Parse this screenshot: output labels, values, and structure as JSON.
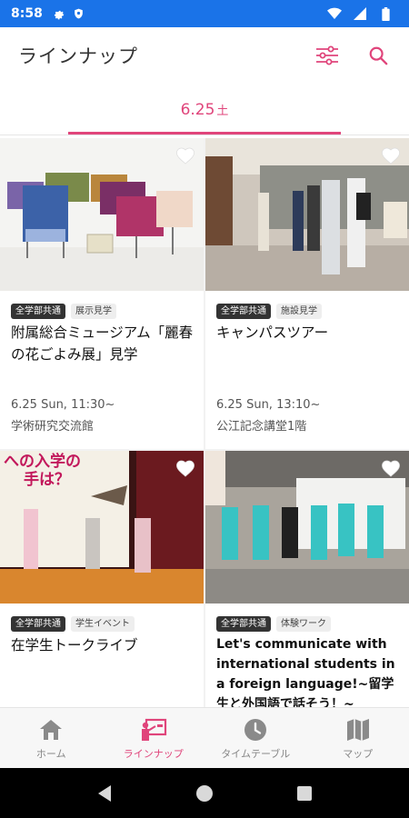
{
  "status_bar": {
    "time": "8:58"
  },
  "app_bar": {
    "title": "ラインナップ"
  },
  "date_tab": {
    "date": "6.25",
    "weekday": "土"
  },
  "cards": [
    {
      "tags": [
        "全学部共通",
        "展示見学"
      ],
      "title": "附属総合ミュージアム「麗春の花ごよみ展」見学",
      "date": "6.25 Sun, 11:30~",
      "place": "学術研究交流館"
    },
    {
      "tags": [
        "全学部共通",
        "施設見学"
      ],
      "title": "キャンパスツアー",
      "date": "6.25 Sun, 13:10~",
      "place": "公江記念講堂1階"
    },
    {
      "tags": [
        "全学部共通",
        "学生イベント"
      ],
      "title": "在学生トークライブ",
      "slide_text": [
        "への入学の",
        "手は？"
      ]
    },
    {
      "tags": [
        "全学部共通",
        "体験ワーク"
      ],
      "title": "Let's communicate with international students in a foreign language!~留学生と外国語で話そう！~"
    }
  ],
  "bottom_nav": [
    {
      "label": "ホーム",
      "icon": "home-icon"
    },
    {
      "label": "ラインナップ",
      "icon": "presentation-icon"
    },
    {
      "label": "タイムテーブル",
      "icon": "clock-icon"
    },
    {
      "label": "マップ",
      "icon": "map-icon"
    }
  ],
  "colors": {
    "accent": "#e0457b",
    "status_bar": "#1a73e8"
  }
}
